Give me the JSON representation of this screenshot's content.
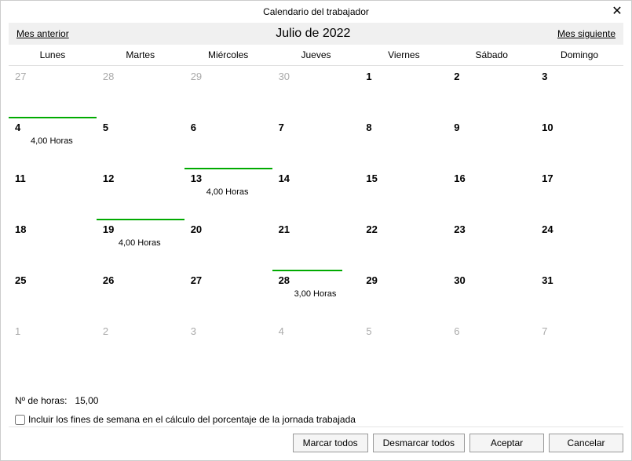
{
  "title": "Calendario del trabajador",
  "nav": {
    "prev": "Mes anterior",
    "next": "Mes siguiente",
    "month": "Julio de 2022"
  },
  "weekdays": [
    "Lunes",
    "Martes",
    "Miércoles",
    "Jueves",
    "Viernes",
    "Sábado",
    "Domingo"
  ],
  "days": [
    {
      "n": "27",
      "other": true
    },
    {
      "n": "28",
      "other": true
    },
    {
      "n": "29",
      "other": true
    },
    {
      "n": "30",
      "other": true
    },
    {
      "n": "1"
    },
    {
      "n": "2"
    },
    {
      "n": "3"
    },
    {
      "n": "4",
      "hours": "4,00 Horas",
      "bar": 100
    },
    {
      "n": "5"
    },
    {
      "n": "6"
    },
    {
      "n": "7"
    },
    {
      "n": "8"
    },
    {
      "n": "9"
    },
    {
      "n": "10"
    },
    {
      "n": "11"
    },
    {
      "n": "12"
    },
    {
      "n": "13",
      "hours": "4,00 Horas",
      "bar": 100
    },
    {
      "n": "14"
    },
    {
      "n": "15"
    },
    {
      "n": "16"
    },
    {
      "n": "17"
    },
    {
      "n": "18"
    },
    {
      "n": "19",
      "hours": "4,00 Horas",
      "bar": 100
    },
    {
      "n": "20"
    },
    {
      "n": "21"
    },
    {
      "n": "22"
    },
    {
      "n": "23"
    },
    {
      "n": "24"
    },
    {
      "n": "25"
    },
    {
      "n": "26"
    },
    {
      "n": "27"
    },
    {
      "n": "28",
      "hours": "3,00 Horas",
      "bar": 80
    },
    {
      "n": "29"
    },
    {
      "n": "30"
    },
    {
      "n": "31"
    },
    {
      "n": "1",
      "other": true
    },
    {
      "n": "2",
      "other": true
    },
    {
      "n": "3",
      "other": true
    },
    {
      "n": "4",
      "other": true
    },
    {
      "n": "5",
      "other": true
    },
    {
      "n": "6",
      "other": true
    },
    {
      "n": "7",
      "other": true
    }
  ],
  "footer": {
    "hours_label": "Nº de horas:",
    "hours_value": "15,00",
    "checkbox_label": "Incluir los fines de semana en el cálculo del porcentaje de la jornada trabajada"
  },
  "buttons": {
    "mark_all": "Marcar todos",
    "unmark_all": "Desmarcar todos",
    "accept": "Aceptar",
    "cancel": "Cancelar"
  }
}
